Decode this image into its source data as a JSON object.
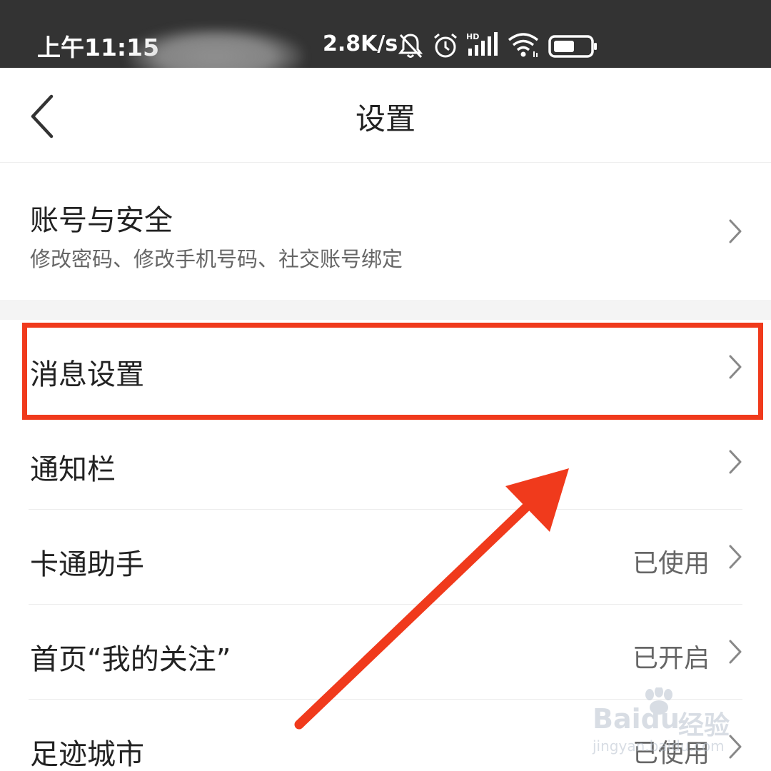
{
  "status_bar": {
    "time": "上午11:15",
    "net_speed": "2.8K/s",
    "icons": [
      "bell-muted-icon",
      "alarm-icon",
      "hd-signal-icon",
      "wifi-icon",
      "battery-icon"
    ],
    "signal_badge": "HD"
  },
  "header": {
    "title": "设置",
    "back_icon": "chevron-left-icon"
  },
  "settings": {
    "account": {
      "label": "账号与安全",
      "sub": "修改密码、修改手机号码、社交账号绑定"
    },
    "message": {
      "label": "消息设置"
    },
    "notification": {
      "label": "通知栏"
    },
    "cartoon": {
      "label": "卡通助手",
      "value": "已使用"
    },
    "homepage": {
      "label": "首页“我的关注”",
      "value": "已开启"
    },
    "footprint": {
      "label": "足迹城市",
      "value": "已使用"
    }
  },
  "annotation": {
    "color": "#f03a1c",
    "highlight_target": "消息设置"
  },
  "watermark": {
    "brand": "Baidu",
    "brand_suffix": "经验",
    "url": "jingyan.baidu.com"
  }
}
